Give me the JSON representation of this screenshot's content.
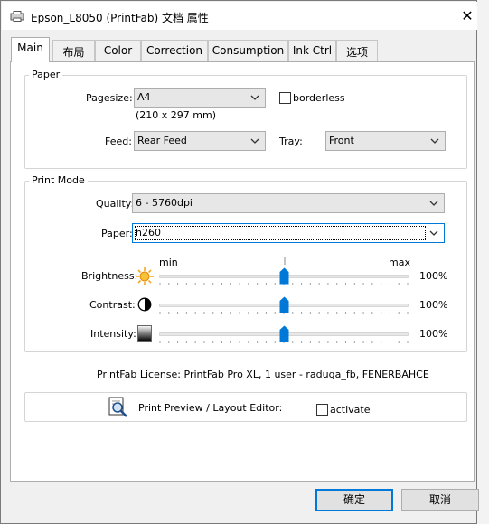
{
  "window": {
    "title": "Epson_L8050 (PrintFab) 文档 属性",
    "close_symbol": "✕"
  },
  "tabs": [
    {
      "label": "Main",
      "active": true
    },
    {
      "label": "布局"
    },
    {
      "label": "Color"
    },
    {
      "label": "Correction"
    },
    {
      "label": "Consumption"
    },
    {
      "label": "Ink Ctrl"
    },
    {
      "label": "选项"
    }
  ],
  "paper_group": {
    "title": "Paper",
    "pagesize_label": "Pagesize:",
    "pagesize_value": "A4",
    "pagesize_dims": "(210 x 297 mm)",
    "borderless_label": "borderless",
    "borderless_checked": false,
    "feed_label": "Feed:",
    "feed_value": "Rear Feed",
    "tray_label": "Tray:",
    "tray_value": "Front"
  },
  "print_mode": {
    "title": "Print Mode",
    "quality_label": "Quality:",
    "quality_value": "6 - 5760dpi",
    "paper_label": "Paper:",
    "paper_value": "h260",
    "min_label": "min",
    "max_label": "max",
    "brightness": {
      "label": "Brightness:",
      "value": "100%",
      "level": 0.5,
      "icon": "sun-icon"
    },
    "contrast": {
      "label": "Contrast:",
      "value": "100%",
      "level": 0.5,
      "icon": "contrast-icon"
    },
    "intensity": {
      "label": "Intensity:",
      "value": "100%",
      "level": 0.5,
      "icon": "gradient-icon"
    }
  },
  "license_text": "PrintFab License: PrintFab Pro XL, 1 user - raduga_fb, FENERBAHCE",
  "preview": {
    "label": "Print Preview / Layout Editor:",
    "activate_label": "activate",
    "activate_checked": false
  },
  "buttons": {
    "ok": "确定",
    "cancel": "取消"
  },
  "colors": {
    "accent": "#0078d7",
    "thumb": "#0078d7",
    "sun": "#f5a623"
  }
}
